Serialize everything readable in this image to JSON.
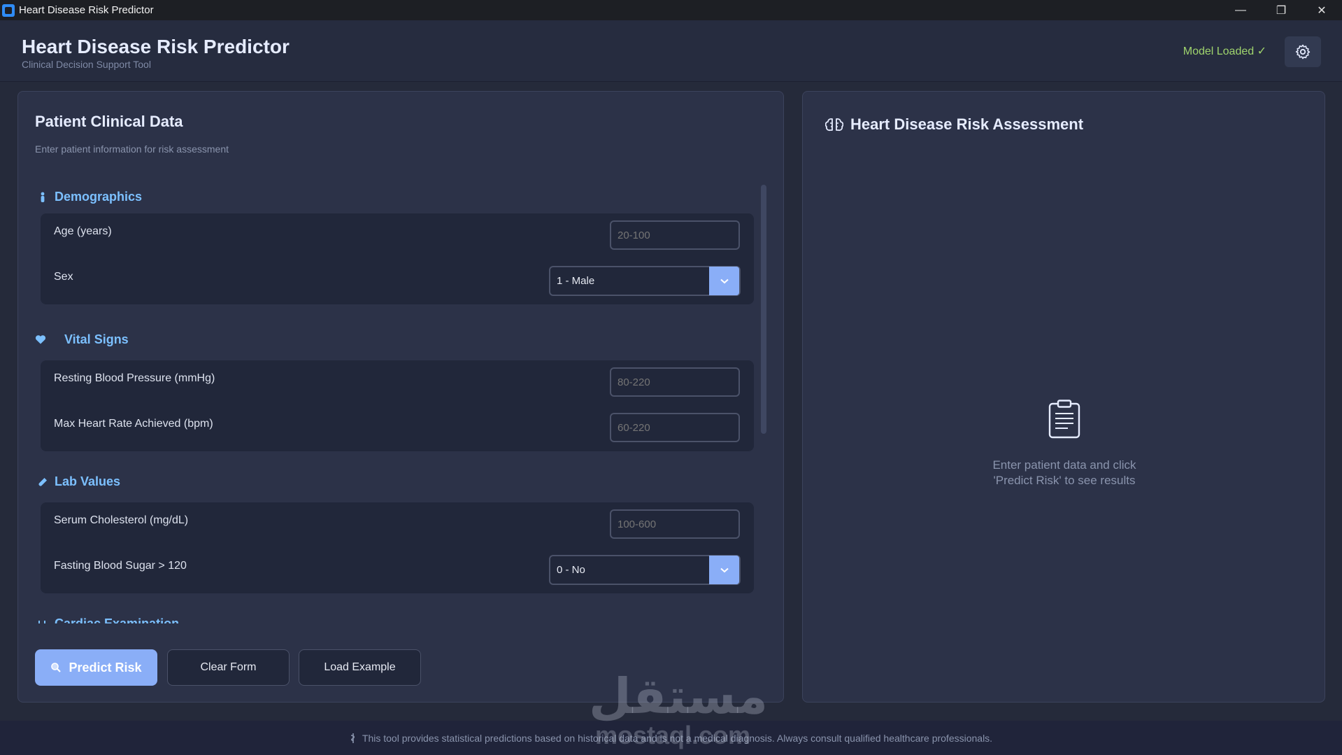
{
  "window": {
    "title": "Heart Disease Risk Predictor",
    "minimize": "—",
    "maximize": "❐",
    "close": "✕"
  },
  "header": {
    "title": "Heart Disease Risk Predictor",
    "subtitle": "Clinical Decision Support Tool",
    "model_status": "Model Loaded ✓",
    "settings_icon": "gear-icon"
  },
  "form": {
    "title": "Patient Clinical Data",
    "subtitle": "Enter patient information for risk assessment",
    "sections": {
      "demographics": {
        "label": "Demographics",
        "fields": {
          "age": {
            "label": "Age (years)",
            "placeholder": "20-100"
          },
          "sex": {
            "label": "Sex",
            "value": "1 - Male"
          }
        }
      },
      "vitals": {
        "label": "Vital Signs",
        "fields": {
          "bp": {
            "label": "Resting Blood Pressure (mmHg)",
            "placeholder": "80-220"
          },
          "hr": {
            "label": "Max Heart Rate Achieved (bpm)",
            "placeholder": "60-220"
          }
        }
      },
      "labs": {
        "label": "Lab Values",
        "fields": {
          "chol": {
            "label": "Serum Cholesterol (mg/dL)",
            "placeholder": "100-600"
          },
          "fbs": {
            "label": "Fasting Blood Sugar > 120",
            "value": "0 - No"
          }
        }
      },
      "cardiac": {
        "label": "Cardiac Examination"
      }
    },
    "buttons": {
      "predict": "Predict Risk",
      "clear": "Clear Form",
      "example": "Load Example"
    }
  },
  "results": {
    "title": "Heart Disease Risk Assessment",
    "placeholder_line1": "Enter patient data and click",
    "placeholder_line2": "'Predict Risk' to see results"
  },
  "footer": {
    "disclaimer": "This tool provides statistical predictions based on historical data and is not a medical diagnosis. Always consult qualified healthcare professionals."
  },
  "watermark": {
    "arabic": "مستقل",
    "latin": "mostaql.com"
  },
  "colors": {
    "accent": "#8aaef7",
    "section_header": "#7cc0ff",
    "status_ok": "#9fd46d"
  }
}
